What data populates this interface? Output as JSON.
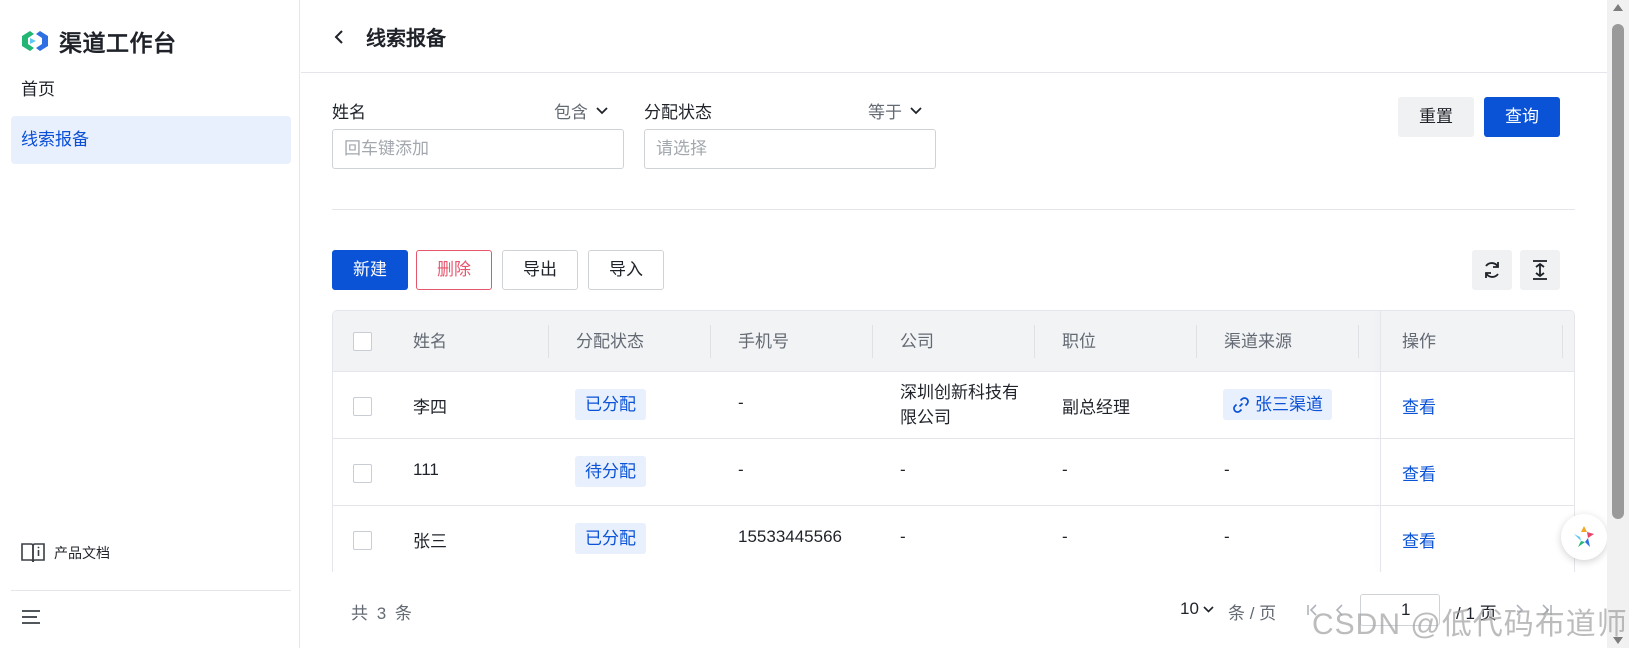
{
  "sidebar": {
    "brand": "渠道工作台",
    "items": [
      {
        "label": "首页",
        "active": false
      },
      {
        "label": "线索报备",
        "active": true
      }
    ],
    "docs_label": "产品文档"
  },
  "header": {
    "title": "线索报备"
  },
  "filters": {
    "name": {
      "label": "姓名",
      "operator": "包含",
      "placeholder": "回车键添加"
    },
    "status": {
      "label": "分配状态",
      "operator": "等于",
      "placeholder": "请选择"
    },
    "reset_label": "重置",
    "query_label": "查询"
  },
  "toolbar": {
    "new_label": "新建",
    "delete_label": "删除",
    "export_label": "导出",
    "import_label": "导入"
  },
  "table": {
    "columns": [
      "姓名",
      "分配状态",
      "手机号",
      "公司",
      "职位",
      "渠道来源",
      "操作"
    ],
    "rows": [
      {
        "name": "李四",
        "status": "已分配",
        "phone": "-",
        "company": "深圳创新科技有限公司",
        "position": "副总经理",
        "source": "张三渠道",
        "action": "查看"
      },
      {
        "name": "111",
        "status": "待分配",
        "phone": "-",
        "company": "-",
        "position": "-",
        "source": "-",
        "action": "查看"
      },
      {
        "name": "张三",
        "status": "已分配",
        "phone": "15533445566",
        "company": "-",
        "position": "-",
        "source": "-",
        "action": "查看"
      }
    ]
  },
  "pagination": {
    "total_text": "共 3 条",
    "page_size": "10",
    "per_page_text": "条 / 页",
    "current_page": "1",
    "total_pages_text": "/ 1 页"
  },
  "watermark": "CSDN @低代码布道师",
  "colors": {
    "primary": "#0a52d6",
    "danger": "#e5566d",
    "active_bg": "#e8effd"
  },
  "icons": [
    "brand-logo-icon",
    "chevron-left-icon",
    "chevron-down-icon",
    "refresh-icon",
    "column-height-icon",
    "link-icon",
    "book-icon",
    "menu-icon",
    "first-page-icon",
    "prev-page-icon",
    "next-page-icon",
    "last-page-icon",
    "assistant-icon"
  ]
}
